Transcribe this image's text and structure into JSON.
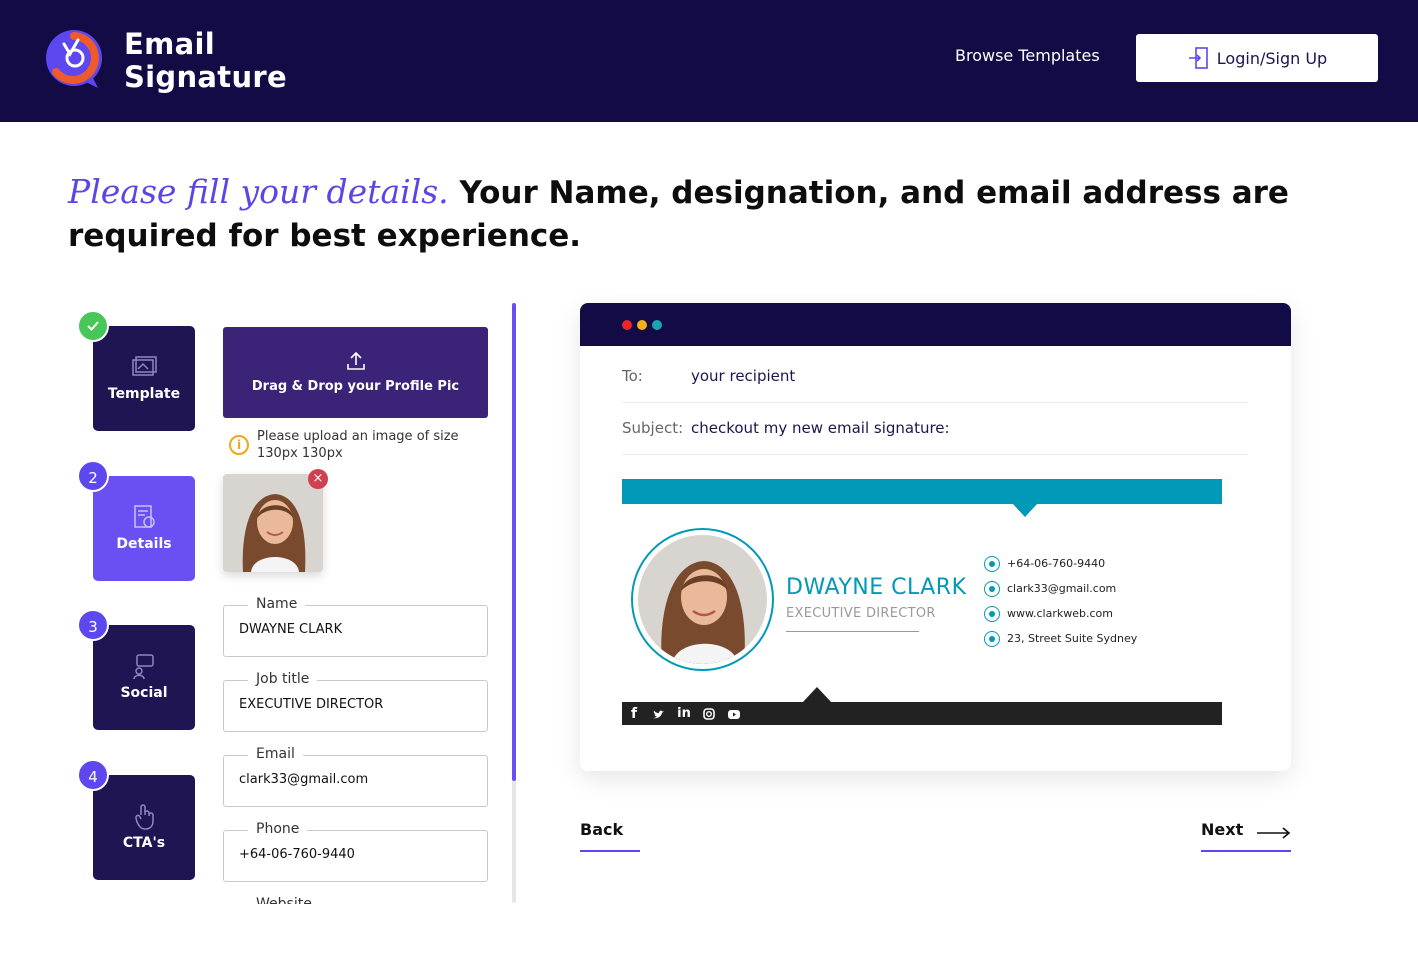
{
  "header": {
    "brand_line1": "Email",
    "brand_line2": "Signature",
    "browse_label": "Browse Templates",
    "login_label": "Login/Sign Up"
  },
  "headline": {
    "script_text": "Please fill your details.",
    "bold_text": "Your Name, designation, and email address are required for best experience."
  },
  "steps": [
    {
      "label": "Template",
      "state": "done",
      "icon": "template-icon"
    },
    {
      "number": "2",
      "label": "Details",
      "state": "active",
      "icon": "details-icon"
    },
    {
      "number": "3",
      "label": "Social",
      "state": "pending",
      "icon": "social-icon"
    },
    {
      "number": "4",
      "label": "CTA's",
      "state": "pending",
      "icon": "cta-icon"
    }
  ],
  "upload": {
    "label": "Drag & Drop your Profile Pic",
    "hint": "Please upload an image of size 130px 130px"
  },
  "fields": {
    "name": {
      "label": "Name",
      "value": "DWAYNE CLARK"
    },
    "job_title": {
      "label": "Job title",
      "value": "EXECUTIVE DIRECTOR"
    },
    "email": {
      "label": "Email",
      "value": "clark33@gmail.com"
    },
    "phone": {
      "label": "Phone",
      "value": "+64-06-760-9440"
    },
    "website": {
      "label": "Website"
    }
  },
  "preview": {
    "to_label": "To:",
    "to_value": "your recipient",
    "subject_label": "Subject:",
    "subject_value": "checkout my new email signature:",
    "signature": {
      "name": "DWAYNE CLARK",
      "title": "EXECUTIVE DIRECTOR",
      "phone": "+64-06-760-9440",
      "email": "clark33@gmail.com",
      "website": "www.clarkweb.com",
      "address": "23, Street Suite Sydney",
      "social": [
        "facebook-icon",
        "twitter-icon",
        "linkedin-icon",
        "instagram-icon",
        "youtube-icon"
      ],
      "accent_color": "#0099b8"
    }
  },
  "nav": {
    "back_label": "Back",
    "next_label": "Next"
  },
  "colors": {
    "header_bg": "#130b45",
    "accent": "#5d48f0",
    "step_done": "#47c65a"
  }
}
